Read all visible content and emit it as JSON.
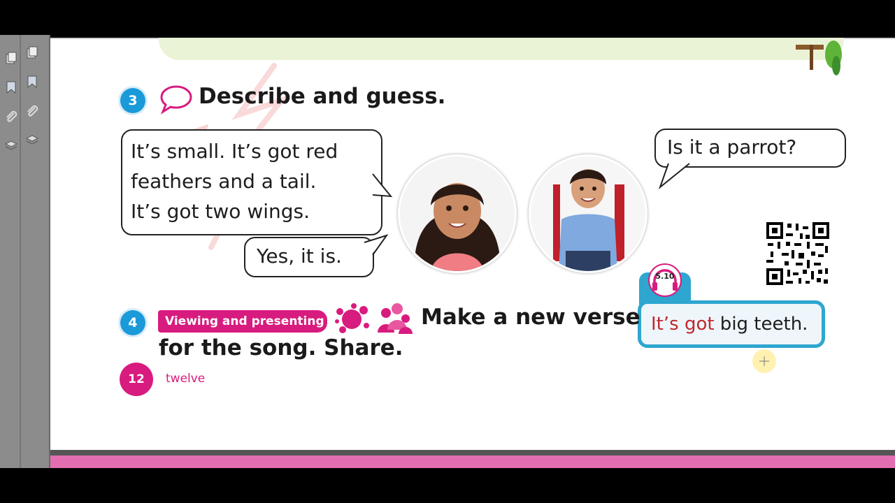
{
  "viewer": {
    "sidebar_icons": [
      {
        "name": "pages-icon"
      },
      {
        "name": "bookmark-icon"
      },
      {
        "name": "attachment-icon"
      },
      {
        "name": "layers-icon"
      }
    ]
  },
  "exercise3": {
    "number": "3",
    "title": "Describe and guess.",
    "speech_icon": "speech-bubble-icon",
    "bubble_left_lines": [
      "It’s small. It’s got red",
      "feathers and a tail.",
      "It’s got two wings."
    ],
    "bubble_answer": "Yes, it is.",
    "bubble_question": "Is it a parrot?"
  },
  "exercise4": {
    "number": "4",
    "badge": "Viewing and presenting",
    "title_line1": "Make a new verse",
    "title_line2": "for the song. Share.",
    "icons": [
      "paint-splat-icon",
      "group-icon"
    ]
  },
  "audio": {
    "track": "5.10",
    "text_colored": "It’s got",
    "text_plain": " big teeth.",
    "colored_color": "#c0282d"
  },
  "footer": {
    "page_number": "12",
    "page_word": "twelve"
  },
  "colors": {
    "accent_blue": "#1a9ad9",
    "accent_pink": "#d81b7e",
    "audio_blue": "#2ea6d0"
  }
}
